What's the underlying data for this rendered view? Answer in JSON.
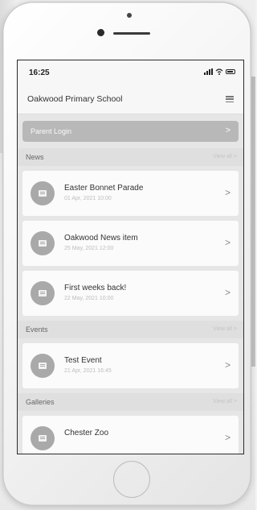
{
  "status": {
    "time": "16:25"
  },
  "header": {
    "title": "Oakwood Primary School"
  },
  "parent_login": {
    "label": "Parent Login",
    "chevron": ">"
  },
  "sections": {
    "news": {
      "title": "News",
      "view_all": "View all >"
    },
    "events": {
      "title": "Events",
      "view_all": "View all >"
    },
    "galleries": {
      "title": "Galleries",
      "view_all": "View all >"
    }
  },
  "news_items": [
    {
      "title": "Easter Bonnet Parade",
      "date": "01 Apr, 2021 10:00"
    },
    {
      "title": "Oakwood News item",
      "date": "25 May, 2021 12:00"
    },
    {
      "title": "First weeks back!",
      "date": "22 May, 2021 10:00"
    }
  ],
  "event_items": [
    {
      "title": "Test Event",
      "date": "21 Apr, 2021 16:45"
    }
  ],
  "gallery_items": [
    {
      "title": "Chester Zoo",
      "date": ""
    }
  ],
  "chevron": ">",
  "icons": {
    "menu": "menu-icon",
    "news": "newspaper-icon",
    "event": "calendar-icon",
    "gallery": "gallery-icon"
  }
}
